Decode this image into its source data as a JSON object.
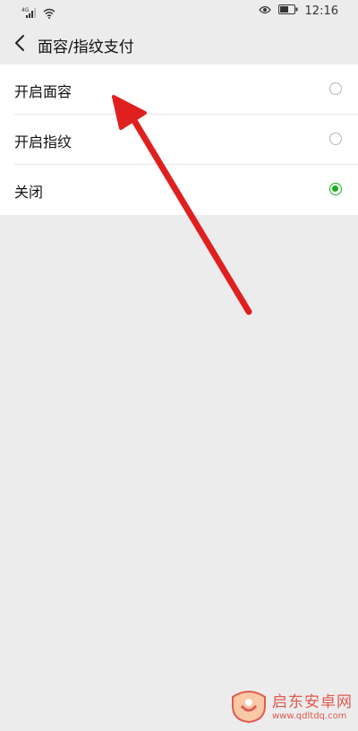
{
  "status_bar": {
    "signal_label": "4G",
    "time": "12:16",
    "icons": [
      "signal-icon",
      "wifi-icon",
      "eye-icon",
      "battery-icon"
    ]
  },
  "nav": {
    "title": "面容/指纹支付",
    "back_icon": "chevron-left-icon"
  },
  "options": [
    {
      "label": "开启面容",
      "selected": false
    },
    {
      "label": "开启指纹",
      "selected": false
    },
    {
      "label": "关闭",
      "selected": true
    }
  ],
  "colors": {
    "accent": "#1aad19",
    "background": "#ececec",
    "annotation_arrow": "#e01f1f"
  },
  "watermark": {
    "title": "启东安卓网",
    "url": "www.qdltdq.com"
  }
}
